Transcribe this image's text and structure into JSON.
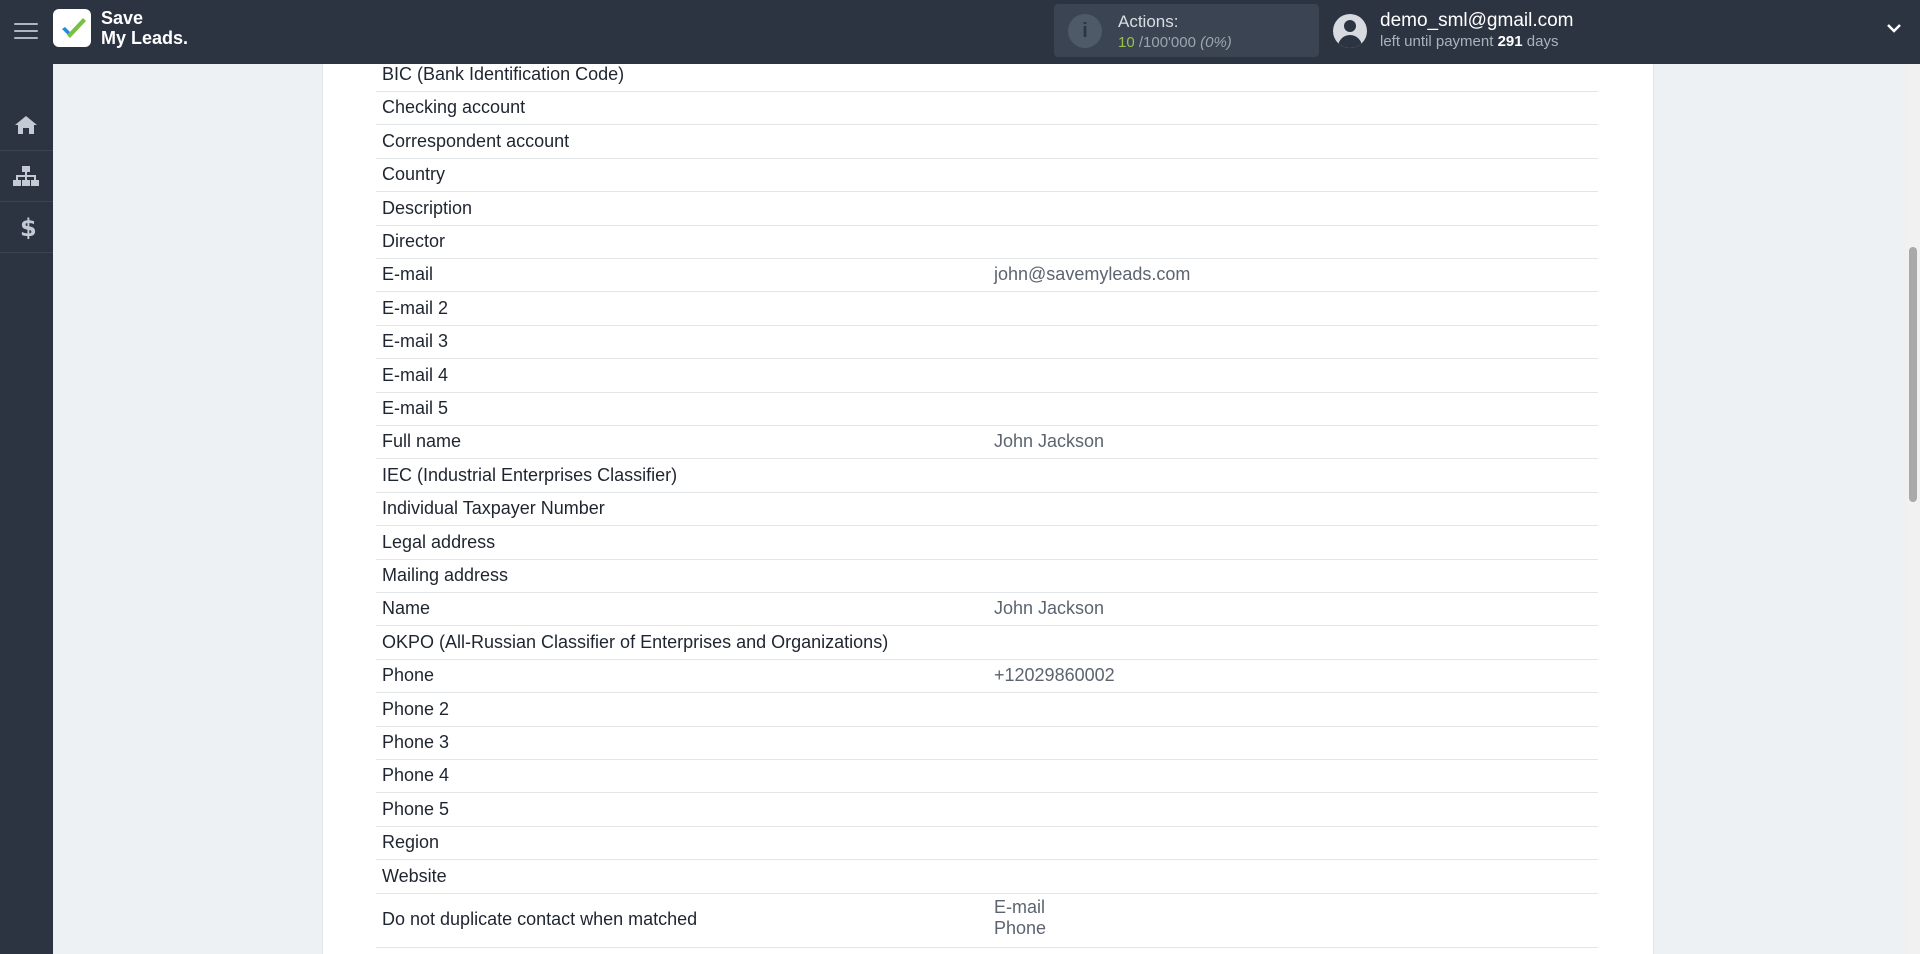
{
  "header": {
    "logo_text": "Save\nMy Leads.",
    "actions_label": "Actions:",
    "actions_used": "10",
    "actions_total": "/100'000",
    "actions_pct": "(0%)",
    "user_email": "demo_sml@gmail.com",
    "payment_prefix": "left until payment",
    "payment_days": "291",
    "payment_suffix": "days"
  },
  "sidebar": {
    "items": [
      {
        "icon": "home-icon"
      },
      {
        "icon": "sitemap-icon"
      },
      {
        "icon": "dollar-icon"
      }
    ]
  },
  "fields": [
    {
      "label": "BIC (Bank Identification Code)",
      "value": ""
    },
    {
      "label": "Checking account",
      "value": ""
    },
    {
      "label": "Correspondent account",
      "value": ""
    },
    {
      "label": "Country",
      "value": ""
    },
    {
      "label": "Description",
      "value": ""
    },
    {
      "label": "Director",
      "value": ""
    },
    {
      "label": "E-mail",
      "value": "john@savemyleads.com"
    },
    {
      "label": "E-mail 2",
      "value": ""
    },
    {
      "label": "E-mail 3",
      "value": ""
    },
    {
      "label": "E-mail 4",
      "value": ""
    },
    {
      "label": "E-mail 5",
      "value": ""
    },
    {
      "label": "Full name",
      "value": "John Jackson"
    },
    {
      "label": "IEC (Industrial Enterprises Classifier)",
      "value": ""
    },
    {
      "label": "Individual Taxpayer Number",
      "value": ""
    },
    {
      "label": "Legal address",
      "value": ""
    },
    {
      "label": "Mailing address",
      "value": ""
    },
    {
      "label": "Name",
      "value": "John Jackson"
    },
    {
      "label": "OKPO (All-Russian Classifier of Enterprises and Organizations)",
      "value": ""
    },
    {
      "label": "Phone",
      "value": "+12029860002"
    },
    {
      "label": "Phone 2",
      "value": ""
    },
    {
      "label": "Phone 3",
      "value": ""
    },
    {
      "label": "Phone 4",
      "value": ""
    },
    {
      "label": "Phone 5",
      "value": ""
    },
    {
      "label": "Region",
      "value": ""
    },
    {
      "label": "Website",
      "value": ""
    }
  ],
  "duplicate": {
    "label": "Do not duplicate contact when matched",
    "value": "E-mail\nPhone"
  },
  "colors": {
    "topbar": "#2c3441",
    "accent_green": "#9bbf4f",
    "logo_check_blue": "#1b8de0",
    "logo_check_green": "#7bc043"
  }
}
